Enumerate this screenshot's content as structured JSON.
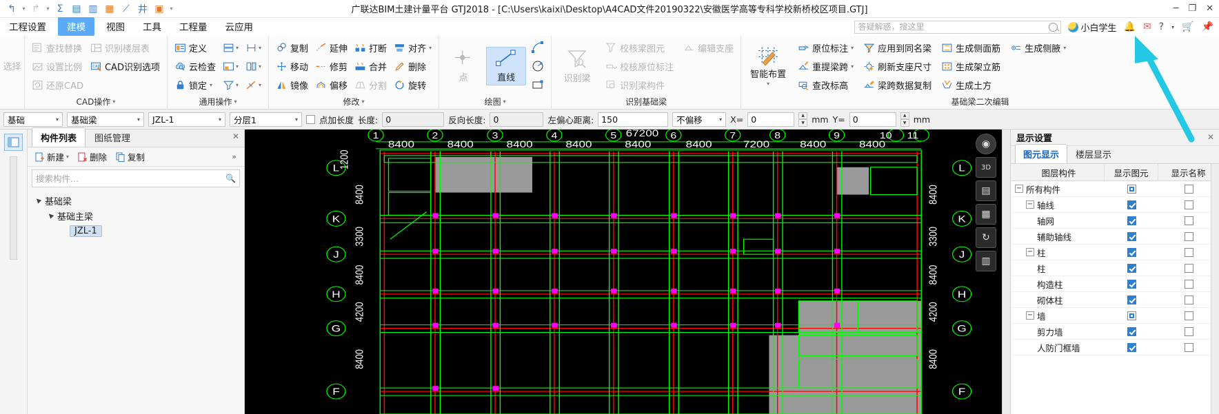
{
  "window": {
    "title": "广联达BIM土建计量平台 GTJ2018 - [C:\\Users\\kaixi\\Desktop\\A4CAD文件20190322\\安徽医学高等专科学校新桥校区项目.GTJ]",
    "minimize": "─",
    "restore": "❐",
    "close": "✕"
  },
  "quick_access": {
    "items": [
      {
        "name": "undo-icon",
        "glyph": "↶"
      },
      {
        "name": "redo-icon",
        "glyph": "↷"
      },
      {
        "name": "sum-icon",
        "glyph": "Σ"
      },
      {
        "name": "save-report-icon",
        "glyph": "▤"
      },
      {
        "name": "view-report-icon",
        "glyph": "▥"
      },
      {
        "name": "check-report-icon",
        "glyph": "▦"
      },
      {
        "name": "measure-icon",
        "glyph": "⟋"
      },
      {
        "name": "grid-icon",
        "glyph": "井"
      },
      {
        "name": "add-layer-icon",
        "glyph": "▣"
      },
      {
        "name": "more-icon",
        "glyph": "▾"
      }
    ]
  },
  "menubar": {
    "items": [
      {
        "label": "工程设置",
        "active": false
      },
      {
        "label": "建模",
        "active": true
      },
      {
        "label": "视图",
        "active": false
      },
      {
        "label": "工具",
        "active": false
      },
      {
        "label": "工程量",
        "active": false
      },
      {
        "label": "云应用",
        "active": false
      }
    ],
    "search_placeholder": "答疑解惑，搜这里",
    "search_value": "",
    "user_name": "小白学生",
    "right_icons": [
      {
        "name": "notification-icon",
        "glyph": "🔔"
      },
      {
        "name": "message-icon",
        "glyph": "✉"
      },
      {
        "name": "help-icon",
        "glyph": "?"
      },
      {
        "name": "settings-icon",
        "glyph": "▾"
      },
      {
        "name": "cart-icon",
        "glyph": "🛒"
      },
      {
        "name": "pin-icon",
        "glyph": "📌"
      }
    ]
  },
  "ribbon": {
    "groups": [
      {
        "title": "CAD操作",
        "has_caret": true,
        "leading_label": "选择",
        "items": [
          {
            "label": "查找替换",
            "icon": "find-replace-icon",
            "disabled": true
          },
          {
            "label": "设置比例",
            "icon": "set-scale-icon",
            "disabled": true
          },
          {
            "label": "还原CAD",
            "icon": "restore-cad-icon",
            "disabled": true
          },
          {
            "label": "识别楼层表",
            "icon": "recognize-floor-table-icon",
            "disabled": true
          },
          {
            "label": "CAD识别选项",
            "icon": "cad-recognize-option-icon",
            "disabled": false
          }
        ]
      },
      {
        "title": "通用操作",
        "has_caret": true,
        "items": [
          {
            "label": "定义",
            "icon": "define-icon",
            "disabled": false
          },
          {
            "label": "云检查",
            "icon": "cloud-check-icon",
            "disabled": false
          },
          {
            "label": "锁定",
            "icon": "lock-icon",
            "disabled": false,
            "caret": true
          }
        ],
        "icon_buttons": [
          {
            "name": "layer-icon",
            "caret": true
          },
          {
            "name": "dimension-icon",
            "caret": true
          },
          {
            "name": "filter-icon",
            "caret": false
          },
          {
            "name": "arrows-icon",
            "caret": true
          },
          {
            "name": "batch-icon",
            "caret": true
          },
          {
            "name": "hatch-icon",
            "caret": true
          }
        ]
      },
      {
        "title": "修改",
        "has_caret": true,
        "items": [
          {
            "label": "复制",
            "icon": "copy-icon",
            "disabled": false
          },
          {
            "label": "移动",
            "icon": "move-icon",
            "disabled": false
          },
          {
            "label": "镜像",
            "icon": "mirror-icon",
            "disabled": false
          },
          {
            "label": "延伸",
            "icon": "extend-icon",
            "disabled": false
          },
          {
            "label": "修剪",
            "icon": "trim-icon",
            "disabled": false
          },
          {
            "label": "偏移",
            "icon": "offset-icon",
            "disabled": false
          },
          {
            "label": "打断",
            "icon": "break-icon",
            "disabled": false
          },
          {
            "label": "合并",
            "icon": "merge-icon",
            "disabled": false
          },
          {
            "label": "分割",
            "icon": "split-icon",
            "disabled": true
          },
          {
            "label": "对齐",
            "icon": "align-icon",
            "disabled": false,
            "caret": true
          },
          {
            "label": "删除",
            "icon": "delete-icon",
            "disabled": false
          },
          {
            "label": "旋转",
            "icon": "rotate-icon",
            "disabled": false
          }
        ]
      },
      {
        "title": "绘图",
        "has_caret": true,
        "big": [
          {
            "label": "点",
            "icon": "point-icon",
            "disabled": true,
            "selected": false
          },
          {
            "label": "直线",
            "icon": "line-icon",
            "disabled": false,
            "selected": true
          }
        ],
        "small": [
          {
            "name": "arc-icon"
          },
          {
            "name": "circle-icon"
          },
          {
            "name": "rectangle-icon"
          }
        ]
      },
      {
        "title": "识别基础梁",
        "has_caret": false,
        "big": [
          {
            "label": "识别梁",
            "icon": "recognize-beam-icon",
            "disabled": true
          }
        ],
        "items": [
          {
            "label": "校核梁图元",
            "icon": "check-beam-element-icon",
            "disabled": true
          },
          {
            "label": "校核原位标注",
            "icon": "check-in-situ-label-icon",
            "disabled": true
          },
          {
            "label": "识别梁构件",
            "icon": "recognize-beam-member-icon",
            "disabled": true
          },
          {
            "label": "编辑支座",
            "icon": "edit-support-icon",
            "disabled": true
          }
        ]
      },
      {
        "title": "基础梁二次编辑",
        "has_caret": false,
        "big": [
          {
            "label": "智能布置",
            "icon": "smart-layout-icon",
            "disabled": false,
            "caret": true
          }
        ],
        "items": [
          {
            "label": "原位标注",
            "icon": "in-situ-label-icon",
            "disabled": false,
            "caret": true
          },
          {
            "label": "重提梁跨",
            "icon": "re-extract-span-icon",
            "disabled": false,
            "caret": true
          },
          {
            "label": "查改标高",
            "icon": "check-elevation-icon",
            "disabled": false
          },
          {
            "label": "应用到同名梁",
            "icon": "apply-same-name-beam-icon",
            "disabled": false
          },
          {
            "label": "刷新支座尺寸",
            "icon": "refresh-support-size-icon",
            "disabled": false
          },
          {
            "label": "梁跨数据复制",
            "icon": "span-data-copy-icon",
            "disabled": false
          },
          {
            "label": "生成侧面筋",
            "icon": "generate-side-bar-icon",
            "disabled": false
          },
          {
            "label": "生成架立筋",
            "icon": "generate-erection-bar-icon",
            "disabled": false
          },
          {
            "label": "生成土方",
            "icon": "generate-earthwork-icon",
            "disabled": false
          },
          {
            "label": "生成侧腋",
            "icon": "generate-side-haunch-icon",
            "disabled": false,
            "caret": true
          }
        ]
      }
    ]
  },
  "options_bar": {
    "leading_label": "基础",
    "type_combo": "基础梁",
    "member_combo": "JZL-1",
    "layer_combo": "分层1",
    "point_add_length_label": "点加长度",
    "point_add_length_checked": false,
    "length_label": "长度:",
    "length_value": "0",
    "reverse_length_label": "反向长度:",
    "reverse_length_value": "0",
    "left_eccentric_label": "左偏心距离:",
    "left_eccentric_value": "150",
    "offset_combo": "不偏移",
    "x_label": "X=",
    "x_value": "0",
    "mm_label_1": "mm",
    "y_label": "Y=",
    "y_value": "0",
    "mm_label_2": "mm"
  },
  "component_panel": {
    "tabs": [
      {
        "label": "构件列表",
        "active": true
      },
      {
        "label": "图纸管理",
        "active": false
      }
    ],
    "close": "✕",
    "toolbar": [
      {
        "label": "新建",
        "icon": "new-icon",
        "caret": true
      },
      {
        "label": "删除",
        "icon": "delete-icon",
        "caret": false
      },
      {
        "label": "复制",
        "icon": "copy-icon",
        "caret": false
      },
      {
        "label": "",
        "icon": "more-chevrons-icon",
        "caret": false
      }
    ],
    "search_placeholder": "搜索构件...",
    "search_value": "",
    "tree": [
      {
        "label": "基础梁",
        "level": 0,
        "expanded": true,
        "selected": false
      },
      {
        "label": "基础主梁",
        "level": 1,
        "expanded": true,
        "selected": false
      },
      {
        "label": "JZL-1",
        "level": 2,
        "expanded": false,
        "selected": true
      }
    ]
  },
  "canvas": {
    "top_dims": [
      "8400",
      "8400",
      "8400",
      "8400",
      "8400",
      "8400",
      "7200",
      "8400",
      "8400"
    ],
    "top_axis_labels": [
      "1",
      "2",
      "3",
      "4",
      "5",
      "6",
      "7",
      "8",
      "9",
      "10",
      "11"
    ],
    "total_dim": "67200",
    "left_axis_labels": [
      "L",
      "K",
      "J",
      "H",
      "G",
      "F"
    ],
    "right_axis_labels": [
      "L",
      "K",
      "J",
      "H",
      "G",
      "F"
    ],
    "left_dims": [
      "8400",
      "3300",
      "8400",
      "4200",
      "8400"
    ],
    "right_dims": [
      "8400",
      "3300",
      "8400",
      "4200",
      "8400"
    ],
    "left_edge_dim": "1200",
    "tools": [
      {
        "name": "view-cube-icon",
        "glyph": "◉"
      },
      {
        "name": "3d-view-icon",
        "glyph": "3D"
      },
      {
        "name": "layer-view-icon",
        "glyph": "▤"
      },
      {
        "name": "plan-view-icon",
        "glyph": "▦"
      },
      {
        "name": "rotate-view-icon",
        "glyph": "↻"
      },
      {
        "name": "legend-icon",
        "glyph": "▥"
      }
    ]
  },
  "display_settings": {
    "title": "显示设置",
    "close": "✕",
    "tabs": [
      {
        "label": "图元显示",
        "active": true
      },
      {
        "label": "楼层显示",
        "active": false
      }
    ],
    "columns": [
      "图层构件",
      "显示图元",
      "显示名称"
    ],
    "rows": [
      {
        "label": "所有构件",
        "level": 0,
        "expander": "−",
        "show_element": "partial",
        "show_name": "off"
      },
      {
        "label": "轴线",
        "level": 1,
        "expander": "−",
        "show_element": "on",
        "show_name": "off"
      },
      {
        "label": "轴网",
        "level": 2,
        "expander": "",
        "show_element": "on",
        "show_name": "off"
      },
      {
        "label": "辅助轴线",
        "level": 2,
        "expander": "",
        "show_element": "on",
        "show_name": "off"
      },
      {
        "label": "柱",
        "level": 1,
        "expander": "−",
        "show_element": "on",
        "show_name": "off"
      },
      {
        "label": "柱",
        "level": 2,
        "expander": "",
        "show_element": "on",
        "show_name": "off"
      },
      {
        "label": "构造柱",
        "level": 2,
        "expander": "",
        "show_element": "on",
        "show_name": "off"
      },
      {
        "label": "砌体柱",
        "level": 2,
        "expander": "",
        "show_element": "on",
        "show_name": "off"
      },
      {
        "label": "墙",
        "level": 1,
        "expander": "−",
        "show_element": "partial",
        "show_name": "off"
      },
      {
        "label": "剪力墙",
        "level": 2,
        "expander": "",
        "show_element": "on",
        "show_name": "off"
      },
      {
        "label": "人防门框墙",
        "level": 2,
        "expander": "",
        "show_element": "on",
        "show_name": "off"
      }
    ]
  },
  "colors": {
    "accent": "#2f7fd0",
    "menu_active_bg": "#5aaaf7",
    "ribbon_bg": "#fbfbfb",
    "canvas_bg": "#000000",
    "grid_green": "#00ff00",
    "grid_red": "#ff0000",
    "magenta_node": "#ff00ff",
    "annotation_arrow": "#00c8e0"
  }
}
